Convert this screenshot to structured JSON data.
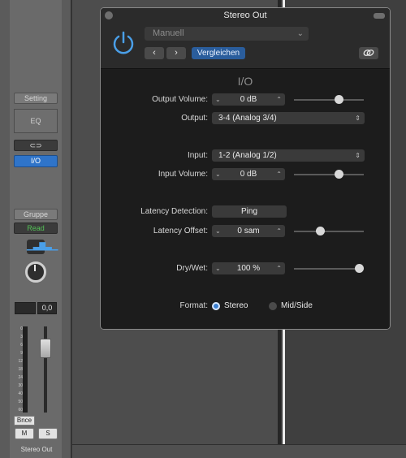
{
  "channel_strip": {
    "setting_label": "Setting",
    "eq_label": "EQ",
    "link_glyph": "⊂⊃",
    "io_label": "I/O",
    "group_label": "Gruppe",
    "read_label": "Read",
    "volume_value": "0,0",
    "scale_ticks": [
      "0",
      "3",
      "6",
      "9",
      "12",
      "18",
      "24",
      "30",
      "40",
      "50",
      "60"
    ],
    "bounce_label": "Bnce",
    "mute_label": "M",
    "solo_label": "S",
    "channel_name": "Stereo Out"
  },
  "plugin": {
    "title": "Stereo Out",
    "preset": "Manuell",
    "prev_glyph": "‹",
    "next_glyph": "›",
    "compare_label": "Vergleichen",
    "link_icon": "link-icon",
    "section_title": "I/O",
    "output_volume": {
      "label": "Output Volume:",
      "value": "0 dB",
      "level": 0.66
    },
    "output": {
      "label": "Output:",
      "value": "3-4 (Analog 3/4)"
    },
    "input": {
      "label": "Input:",
      "value": "1-2 (Analog 1/2)"
    },
    "input_volume": {
      "label": "Input Volume:",
      "value": "0 dB",
      "level": 0.66
    },
    "latency_detection": {
      "label": "Latency Detection:",
      "button": "Ping"
    },
    "latency_offset": {
      "label": "Latency Offset:",
      "value": "0 sam",
      "level": 0.36
    },
    "dry_wet": {
      "label": "Dry/Wet:",
      "value": "100 %",
      "level": 1.0
    },
    "format": {
      "label": "Format:",
      "option_stereo": "Stereo",
      "option_midside": "Mid/Side",
      "selected": "Stereo"
    }
  },
  "colors": {
    "accent_blue": "#2f74c9",
    "read_green": "#53c256",
    "power_blue": "#4a9fe8"
  }
}
